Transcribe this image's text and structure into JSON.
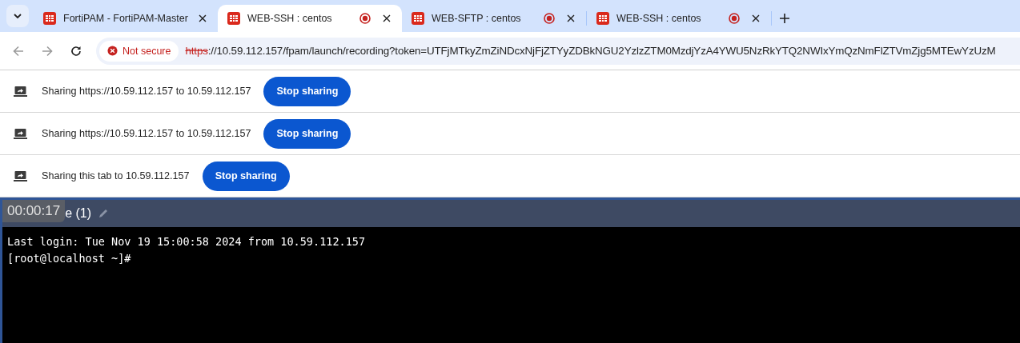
{
  "tabs": [
    {
      "title": "FortiPAM - FortiPAM-Master",
      "selected": false,
      "recording": false
    },
    {
      "title": "WEB-SSH : centos",
      "selected": true,
      "recording": true
    },
    {
      "title": "WEB-SFTP : centos",
      "selected": false,
      "recording": true
    },
    {
      "title": "WEB-SSH : centos",
      "selected": false,
      "recording": true
    }
  ],
  "address_bar": {
    "security": "Not secure",
    "scheme": "https",
    "rest": "://10.59.112.157/fpam/launch/recording?token=UTFjMTkyZmZiNDcxNjFjZTYyZDBkNGU2YzlzZTM0MzdjYzA4YWU5NzRkYTQ2NWIxYmQzNmFlZTVmZjg5MTEwYzUzM"
  },
  "infobars": [
    {
      "text": "Sharing https://10.59.112.157 to 10.59.112.157",
      "button": "Stop sharing"
    },
    {
      "text": "Sharing https://10.59.112.157 to 10.59.112.157",
      "button": "Stop sharing"
    },
    {
      "text": "Sharing this tab to 10.59.112.157",
      "button": "Stop sharing"
    }
  ],
  "console": {
    "title": "e (1)",
    "timer": "00:00:17",
    "lines": [
      "Last login: Tue Nov 19 15:00:58 2024 from 10.59.112.157",
      "[root@localhost ~]#"
    ]
  }
}
